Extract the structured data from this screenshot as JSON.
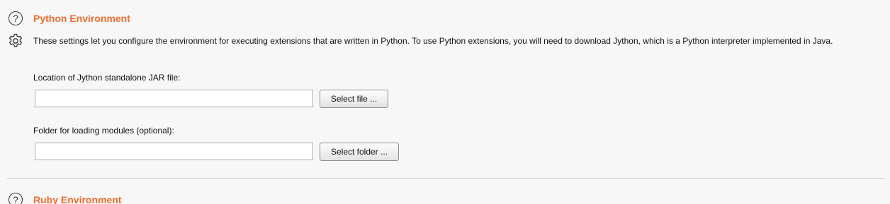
{
  "python_section": {
    "title": "Python Environment",
    "help_icon": "question-circle-icon",
    "settings_icon": "gear-icon",
    "description": "These settings let you configure the environment for executing extensions that are written in Python. To use Python extensions, you will need to download Jython, which is a Python interpreter implemented in Java.",
    "jar_label": "Location of Jython standalone JAR file:",
    "jar_value": "",
    "jar_button": "Select file ...",
    "folder_label": "Folder for loading modules (optional):",
    "folder_value": "",
    "folder_button": "Select folder ..."
  },
  "ruby_section": {
    "title": "Ruby Environment",
    "help_icon": "question-circle-icon"
  },
  "colors": {
    "section_title": "#ee6c2f",
    "background": "#f7f7f7"
  }
}
